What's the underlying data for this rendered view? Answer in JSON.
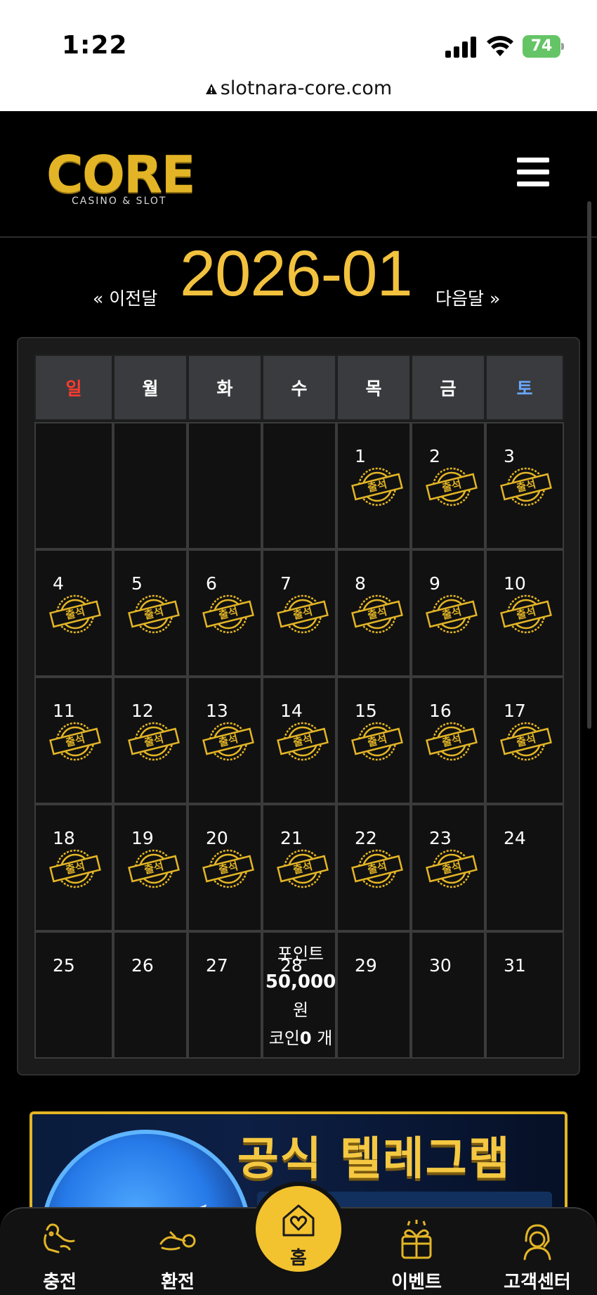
{
  "status_bar": {
    "time": "1:22",
    "battery": "74"
  },
  "browser": {
    "url": "slotnara-core.com"
  },
  "header": {
    "logo_text": "CORE",
    "logo_sub": "CASINO & SLOT"
  },
  "month_nav": {
    "prev_label": "« 이전달",
    "title": "2026-01",
    "next_label": "다음달 »"
  },
  "calendar": {
    "weekdays": [
      "일",
      "월",
      "화",
      "수",
      "목",
      "금",
      "토"
    ],
    "stamp_label": "출석",
    "weeks": [
      [
        null,
        null,
        null,
        null,
        {
          "day": "1",
          "attended": true
        },
        {
          "day": "2",
          "attended": true
        },
        {
          "day": "3",
          "attended": true
        }
      ],
      [
        {
          "day": "4",
          "attended": true
        },
        {
          "day": "5",
          "attended": true
        },
        {
          "day": "6",
          "attended": true
        },
        {
          "day": "7",
          "attended": true
        },
        {
          "day": "8",
          "attended": true
        },
        {
          "day": "9",
          "attended": true
        },
        {
          "day": "10",
          "attended": true
        }
      ],
      [
        {
          "day": "11",
          "attended": true
        },
        {
          "day": "12",
          "attended": true
        },
        {
          "day": "13",
          "attended": true
        },
        {
          "day": "14",
          "attended": true
        },
        {
          "day": "15",
          "attended": true
        },
        {
          "day": "16",
          "attended": true
        },
        {
          "day": "17",
          "attended": true
        }
      ],
      [
        {
          "day": "18",
          "attended": true
        },
        {
          "day": "19",
          "attended": true
        },
        {
          "day": "20",
          "attended": true
        },
        {
          "day": "21",
          "attended": true
        },
        {
          "day": "22",
          "attended": true
        },
        {
          "day": "23",
          "attended": true
        },
        {
          "day": "24",
          "attended": false
        }
      ],
      [
        {
          "day": "25",
          "attended": false
        },
        {
          "day": "26",
          "attended": false
        },
        {
          "day": "27",
          "attended": false
        },
        {
          "day": "28",
          "attended": false,
          "today": true
        },
        {
          "day": "29",
          "attended": false
        },
        {
          "day": "30",
          "attended": false
        },
        {
          "day": "31",
          "attended": false
        }
      ]
    ],
    "today_info": {
      "point_label": "포인트",
      "point_amount": "50,000",
      "point_unit": "원",
      "coin_label": "코인",
      "coin_amount": "0",
      "coin_unit": " 개"
    }
  },
  "banner": {
    "title": "공식 텔레그램"
  },
  "bottom_nav": {
    "items": [
      {
        "label": "충전",
        "icon": "deposit-icon"
      },
      {
        "label": "환전",
        "icon": "withdraw-icon"
      },
      {
        "label": "홈",
        "icon": "home-icon"
      },
      {
        "label": "이벤트",
        "icon": "gift-icon"
      },
      {
        "label": "고객센터",
        "icon": "support-icon"
      }
    ]
  },
  "colors": {
    "accent_gold": "#f2c23e",
    "sunday": "#ff3b30",
    "saturday": "#6aa8ff"
  }
}
